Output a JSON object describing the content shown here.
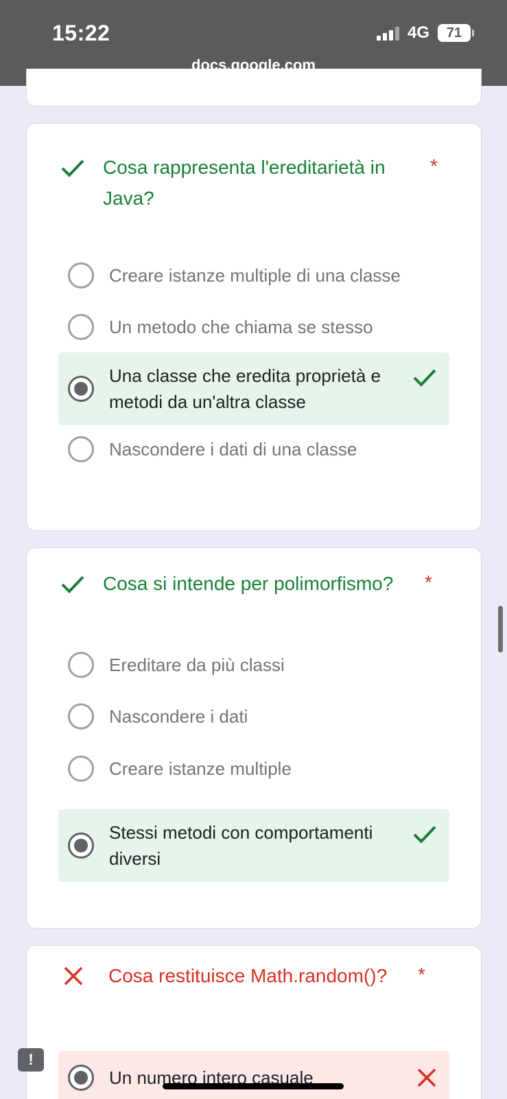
{
  "status_bar": {
    "time": "15:22",
    "network": "4G",
    "battery": "71",
    "url": "docs.google.com"
  },
  "colors": {
    "correct": "#188038",
    "incorrect": "#d93025",
    "correct_bg": "#e6f4ea",
    "incorrect_bg": "#fce8e6",
    "page_bg": "#ede9f6"
  },
  "questions": [
    {
      "status": "correct",
      "status_icon": "check-icon",
      "title_line1": "Cosa rappresenta l'ereditarietà in",
      "title_line2": "Java?",
      "required_mark": "*",
      "options": [
        {
          "label": "Creare istanze multiple di una classe",
          "selected": false
        },
        {
          "label": "Un metodo che chiama se stesso",
          "selected": false
        },
        {
          "label_line1": "Una classe che eredita proprietà e",
          "label_line2": "metodi da un'altra classe",
          "selected": true,
          "result_icon": "check-icon"
        },
        {
          "label": "Nascondere i dati di una classe",
          "selected": false
        }
      ]
    },
    {
      "status": "correct",
      "status_icon": "check-icon",
      "title": "Cosa si intende per polimorfismo?",
      "required_mark": "*",
      "options": [
        {
          "label": "Ereditare da più classi",
          "selected": false
        },
        {
          "label": "Nascondere i dati",
          "selected": false
        },
        {
          "label": "Creare istanze multiple",
          "selected": false
        },
        {
          "label_line1": "Stessi metodi con comportamenti",
          "label_line2": "diversi",
          "selected": true,
          "result_icon": "check-icon"
        }
      ]
    },
    {
      "status": "incorrect",
      "status_icon": "cross-icon",
      "title": "Cosa restituisce Math.random()?",
      "required_mark": "*",
      "options": [
        {
          "label": "Un numero intero casuale",
          "selected": true,
          "result_icon": "cross-icon"
        }
      ]
    }
  ],
  "feedback_button": {
    "glyph": "!"
  }
}
